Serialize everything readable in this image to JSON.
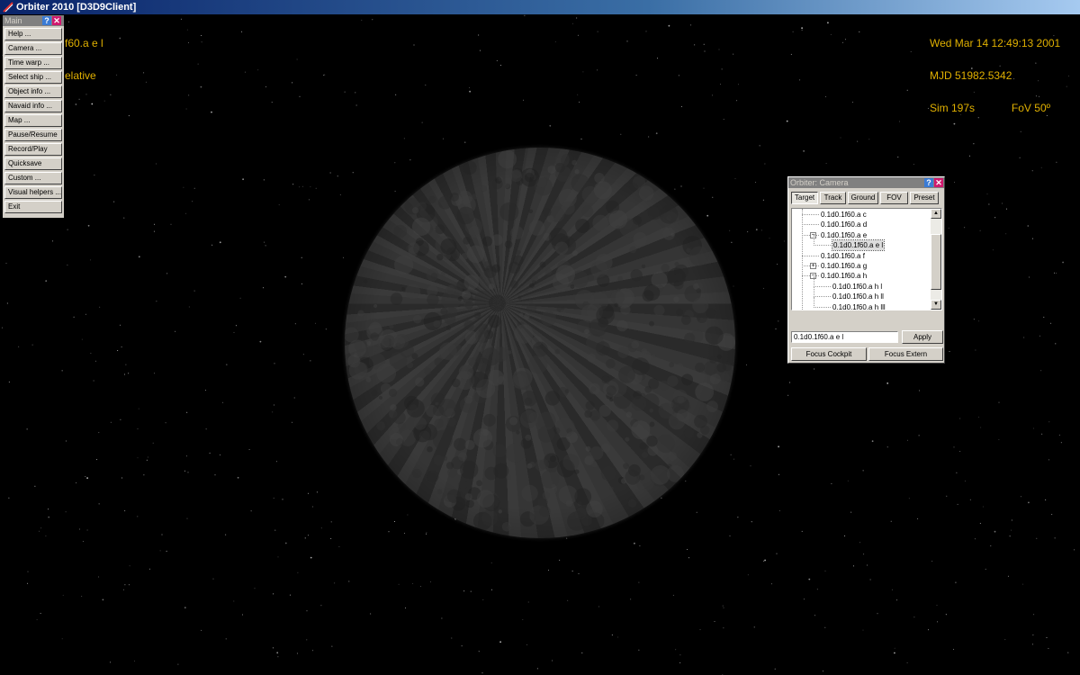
{
  "window": {
    "title": "Orbiter 2010 [D3D9Client]"
  },
  "hud": {
    "left_line1": "f60.a e l",
    "left_line2": "elative",
    "date": "Wed Mar 14 12:49:13 2001",
    "mjd": "MJD 51982.5342",
    "sim": "Sim 197s",
    "fov": "FoV 50º"
  },
  "main_menu": {
    "caption": "Main",
    "help_glyph": "?",
    "close_glyph": "✕",
    "items": [
      {
        "label": "Help ..."
      },
      {
        "label": "Camera ..."
      },
      {
        "label": "Time warp ..."
      },
      {
        "label": "Select ship ..."
      },
      {
        "label": "Object info ..."
      },
      {
        "label": "Navaid info ..."
      },
      {
        "label": "Map ..."
      },
      {
        "label": "Pause/Resume"
      },
      {
        "label": "Record/Play"
      },
      {
        "label": "Quicksave"
      },
      {
        "label": "Custom ..."
      },
      {
        "label": "Visual helpers ..."
      },
      {
        "label": "Exit"
      }
    ]
  },
  "camera_dialog": {
    "caption": "Orbiter: Camera",
    "tabs": [
      {
        "label": "Target",
        "active": true
      },
      {
        "label": "Track"
      },
      {
        "label": "Ground"
      },
      {
        "label": "FOV"
      },
      {
        "label": "Preset"
      }
    ],
    "tree_nodes": [
      {
        "label": "0.1d0.1f60.a c",
        "level": 1
      },
      {
        "label": "0.1d0.1f60.a d",
        "level": 1
      },
      {
        "label": "0.1d0.1f60.a e",
        "level": 1,
        "expander": "−"
      },
      {
        "label": "0.1d0.1f60.a e l",
        "level": 2,
        "selected": true
      },
      {
        "label": "0.1d0.1f60.a f",
        "level": 1
      },
      {
        "label": "0.1d0.1f60.a g",
        "level": 1,
        "expander": "+"
      },
      {
        "label": "0.1d0.1f60.a h",
        "level": 1,
        "expander": "−"
      },
      {
        "label": "0.1d0.1f60.a h l",
        "level": 2
      },
      {
        "label": "0.1d0.1f60.a h ll",
        "level": 2
      },
      {
        "label": "0.1d0.1f60.a h lll",
        "level": 2
      }
    ],
    "target_value": "0.1d0.1f60.a e l",
    "apply_label": "Apply",
    "focus_cockpit_label": "Focus Cockpit",
    "focus_extern_label": "Focus Extern"
  },
  "colors": {
    "hud_text": "#e0b000",
    "titlebar": "#0a246a",
    "dialog_bg": "#d4d0c8"
  },
  "icons": {
    "app": "orbiter-app-icon",
    "help": "help-icon",
    "close": "close-icon",
    "scroll_up": "scroll-up-arrow-icon",
    "scroll_down": "scroll-down-arrow-icon"
  }
}
